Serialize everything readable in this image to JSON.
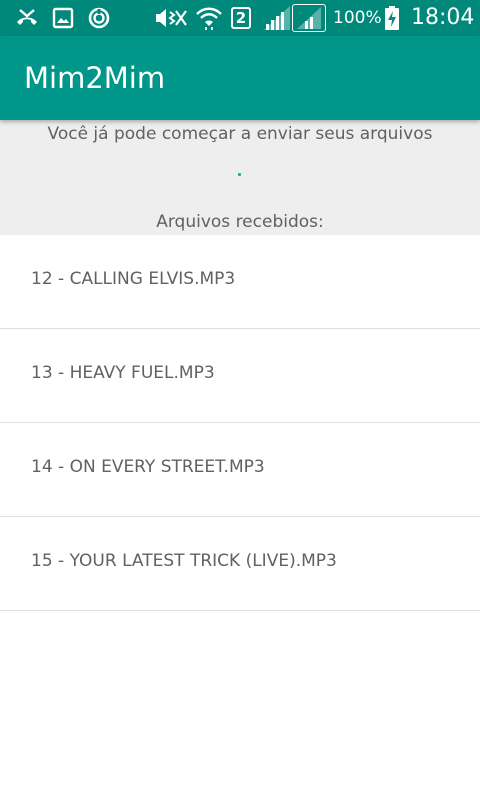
{
  "status_bar": {
    "icons": [
      "missed-call-icon",
      "image-icon",
      "sync-icon",
      "vibrate-icon",
      "wifi-icon",
      "sim-2-badge",
      "signal-icon",
      "signal-icon",
      "battery-charging-icon"
    ],
    "sim_badge": "2",
    "battery_percent": "100%",
    "clock": "18:04"
  },
  "app_bar": {
    "title": "Mim2Mim"
  },
  "info": {
    "message": "Você já pode começar a enviar seus arquivos",
    "received_label": "Arquivos recebidos:"
  },
  "files": [
    {
      "name": "12 - CALLING ELVIS.MP3"
    },
    {
      "name": "13 - HEAVY FUEL.MP3"
    },
    {
      "name": "14 - ON EVERY STREET.MP3"
    },
    {
      "name": "15 - YOUR LATEST TRICK (LIVE).MP3"
    }
  ],
  "colors": {
    "status_bar": "#00897b",
    "app_bar": "#00968a",
    "panel": "#eeeeee",
    "text": "#616161",
    "accent": "#26a69a"
  }
}
